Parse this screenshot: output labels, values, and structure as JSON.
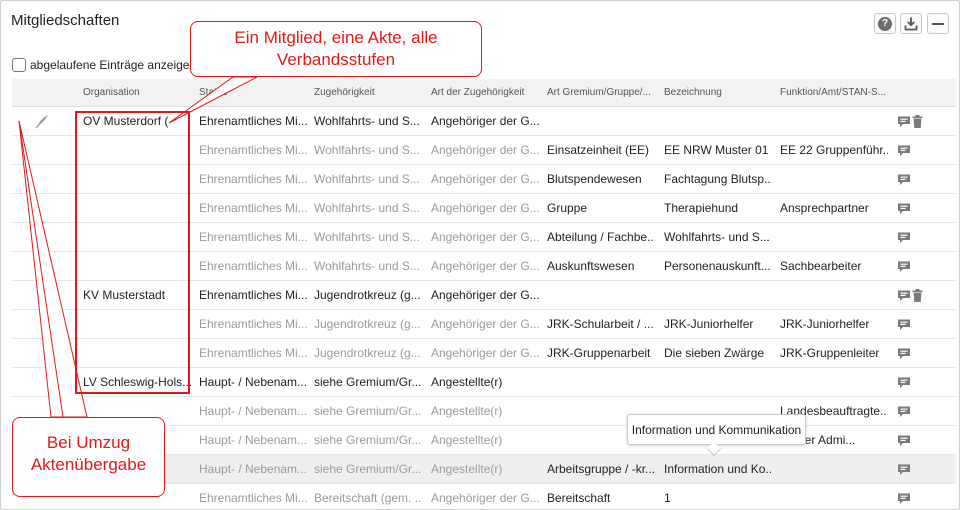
{
  "panel": {
    "title": "Mitgliedschaften",
    "show_expired_label": "abgelaufene Einträge anzeigen",
    "help_icon": "question-circle-icon",
    "download_icon": "tray-download-icon",
    "minimize_icon": "minus-icon"
  },
  "table": {
    "columns": [
      "Organisation",
      "Status",
      "Zugehörigkeit",
      "Art der Zugehörigkeit",
      "Art Gremium/Gruppe/...",
      "Bezeichnung",
      "Funktion/Amt/STAN-S..."
    ],
    "rows": [
      {
        "org": "OV Musterdorf (",
        "status": "Ehrenamtliches Mi...",
        "zug": "Wohlfahrts- und S...",
        "art": "Angehöriger der G...",
        "gremium": "",
        "bez": "",
        "funk": "",
        "dim": false,
        "trash": true,
        "edit": true
      },
      {
        "org": "",
        "status": "Ehrenamtliches Mi...",
        "zug": "Wohlfahrts- und S...",
        "art": "Angehöriger der G...",
        "gremium": "Einsatzeinheit (EE)",
        "bez": "EE NRW Muster 01",
        "funk": "EE 22 Gruppenführ...",
        "dim": true,
        "trash": false
      },
      {
        "org": "",
        "status": "Ehrenamtliches Mi...",
        "zug": "Wohlfahrts- und S...",
        "art": "Angehöriger der G...",
        "gremium": "Blutspendewesen",
        "bez": "Fachtagung Blutsp...",
        "funk": "",
        "dim": true,
        "trash": false
      },
      {
        "org": "",
        "status": "Ehrenamtliches Mi...",
        "zug": "Wohlfahrts- und S...",
        "art": "Angehöriger der G...",
        "gremium": "Gruppe",
        "bez": "Therapiehund",
        "funk": "Ansprechpartner",
        "dim": true,
        "trash": false
      },
      {
        "org": "",
        "status": "Ehrenamtliches Mi...",
        "zug": "Wohlfahrts- und S...",
        "art": "Angehöriger der G...",
        "gremium": "Abteilung / Fachbe...",
        "bez": "Wohlfahrts- und S...",
        "funk": "",
        "dim": true,
        "trash": false
      },
      {
        "org": "",
        "status": "Ehrenamtliches Mi...",
        "zug": "Wohlfahrts- und S...",
        "art": "Angehöriger der G...",
        "gremium": "Auskunftswesen",
        "bez": "Personenauskunft...",
        "funk": "Sachbearbeiter",
        "dim": true,
        "trash": false
      },
      {
        "org": "KV Musterstadt",
        "status": "Ehrenamtliches Mi...",
        "zug": "Jugendrotkreuz (g...",
        "art": "Angehöriger der G...",
        "gremium": "",
        "bez": "",
        "funk": "",
        "dim": false,
        "trash": true
      },
      {
        "org": "",
        "status": "Ehrenamtliches Mi...",
        "zug": "Jugendrotkreuz (g...",
        "art": "Angehöriger der G...",
        "gremium": "JRK-Schularbeit / ...",
        "bez": "JRK-Juniorhelfer",
        "funk": "JRK-Juniorhelfer",
        "dim": true,
        "trash": false
      },
      {
        "org": "",
        "status": "Ehrenamtliches Mi...",
        "zug": "Jugendrotkreuz (g...",
        "art": "Angehöriger der G...",
        "gremium": "JRK-Gruppenarbeit",
        "bez": "Die sieben Zwärge",
        "funk": "JRK-Gruppenleiter",
        "dim": true,
        "trash": false
      },
      {
        "org": "LV Schleswig-Hols...",
        "status": "Haupt- / Nebenam...",
        "zug": "siehe Gremium/Gr...",
        "art": "Angestellte(r)",
        "gremium": "",
        "bez": "",
        "funk": "",
        "dim": false,
        "trash": false
      },
      {
        "org": "",
        "status": "Haupt- / Nebenam...",
        "zug": "siehe Gremium/Gr...",
        "art": "Angestellte(r)",
        "gremium": "",
        "bez": "",
        "funk": "Landesbeauftragte...",
        "dim": true,
        "trash": false
      },
      {
        "org": "",
        "status": "Haupt- / Nebenam...",
        "zug": "siehe Gremium/Gr...",
        "art": "Angestellte(r)",
        "gremium": "",
        "bez": "",
        "funk": "Server Admi...",
        "dim": true,
        "trash": false
      },
      {
        "org": "",
        "status": "Haupt- / Nebenam...",
        "zug": "siehe Gremium/Gr...",
        "art": "Angestellte(r)",
        "gremium": "Arbeitsgruppe / -kr...",
        "bez": "Information und Ko...",
        "funk": "",
        "dim": true,
        "trash": false,
        "highlight": true
      },
      {
        "org": "",
        "status": "Ehrenamtliches Mi...",
        "zug": "Bereitschaft (gem. ...",
        "art": "Angehöriger der G...",
        "gremium": "Bereitschaft",
        "bez": "1",
        "funk": "",
        "dim": true,
        "trash": false
      }
    ]
  },
  "annotations": {
    "top_callout": [
      "Ein Mitglied, eine Akte, alle",
      "Verbandsstufen"
    ],
    "bottom_callout": [
      "Bei Umzug",
      "Aktenübergabe"
    ],
    "accent_color": "#e11919"
  },
  "tooltip": {
    "text": "Information und Kommunikation"
  }
}
